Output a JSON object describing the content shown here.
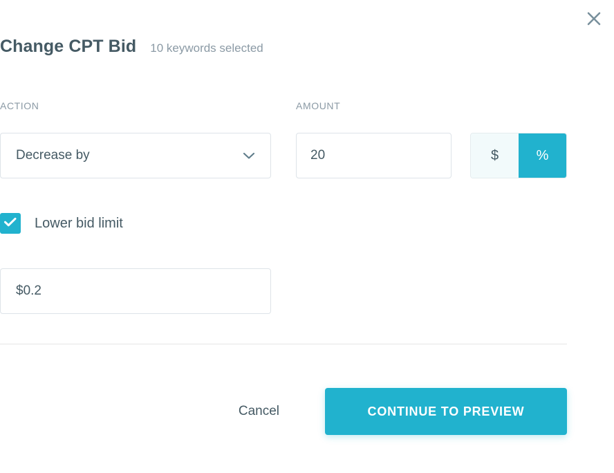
{
  "modal": {
    "title": "Change CPT Bid",
    "subtitle": "10 keywords selected",
    "close_icon": "close-icon"
  },
  "form": {
    "action": {
      "label": "ACTION",
      "selected": "Decrease by",
      "chevron_icon": "chevron-down-icon"
    },
    "amount": {
      "label": "AMOUNT",
      "value": "20",
      "unit_toggle": {
        "options": [
          "$",
          "%"
        ],
        "selected": "%",
        "dollar_label": "$",
        "percent_label": "%"
      }
    },
    "lower_bid_limit": {
      "label": "Lower bid limit",
      "checked": true,
      "check_icon": "check-icon",
      "value": "$0.2"
    }
  },
  "footer": {
    "cancel_label": "Cancel",
    "primary_label": "CONTINUE TO PREVIEW"
  },
  "colors": {
    "accent": "#21b2ce",
    "accent_soft": "#f2fafb",
    "text_dark": "#455a64",
    "text_muted": "#8b9aa5",
    "border": "#dde3e8",
    "divider": "#e6e6e6"
  }
}
